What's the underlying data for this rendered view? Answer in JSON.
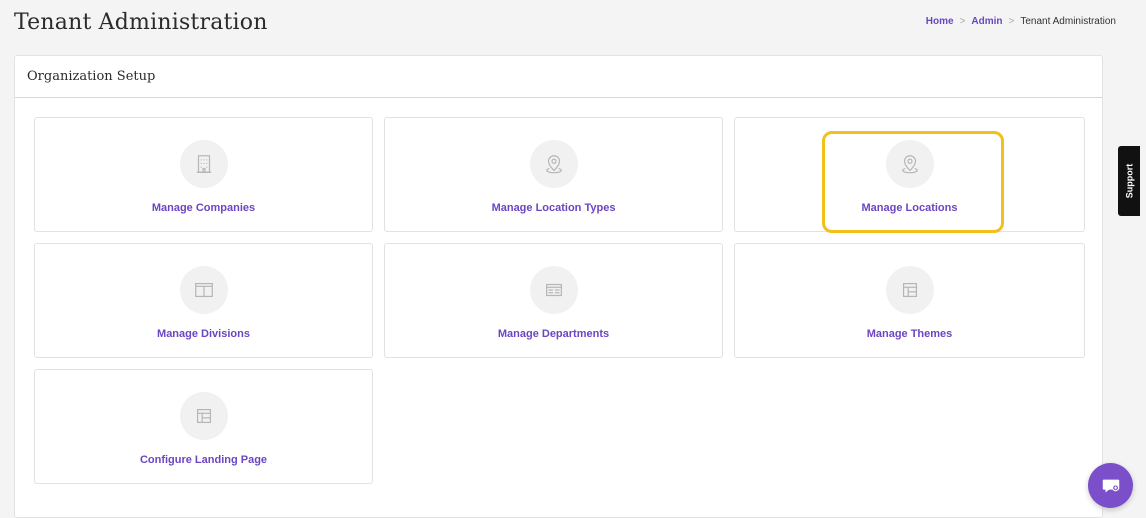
{
  "header": {
    "title": "Tenant Administration"
  },
  "breadcrumb": {
    "items": [
      {
        "label": "Home",
        "link": true
      },
      {
        "label": "Admin",
        "link": true
      },
      {
        "label": "Tenant Administration",
        "link": false
      }
    ],
    "separator": ">"
  },
  "panel": {
    "title": "Organization Setup",
    "cards": [
      {
        "label": "Manage Companies",
        "icon": "building-icon"
      },
      {
        "label": "Manage Location Types",
        "icon": "location-pin-icon"
      },
      {
        "label": "Manage Locations",
        "icon": "location-pin-icon",
        "highlighted": true
      },
      {
        "label": "Manage Divisions",
        "icon": "columns-icon"
      },
      {
        "label": "Manage Departments",
        "icon": "table-icon"
      },
      {
        "label": "Manage Themes",
        "icon": "layout-icon"
      },
      {
        "label": "Configure Landing Page",
        "icon": "layout-icon"
      }
    ]
  },
  "support": {
    "label": "Support"
  },
  "colors": {
    "accent": "#6b46c1",
    "highlight": "#f2c01b",
    "fab": "#7b4fc9"
  }
}
